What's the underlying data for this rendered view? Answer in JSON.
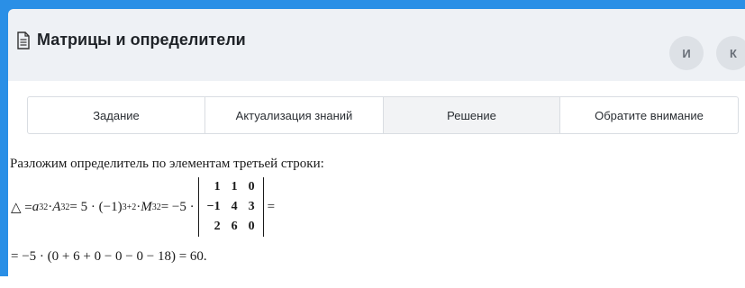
{
  "header": {
    "title": "Матрицы и определители",
    "avatars": [
      "И",
      "К"
    ]
  },
  "tabs": [
    {
      "label": "Задание",
      "active": false
    },
    {
      "label": "Актуализация знаний",
      "active": false
    },
    {
      "label": "Решение",
      "active": true
    },
    {
      "label": "Обратите внимание",
      "active": false
    }
  ],
  "solution": {
    "intro": "Разложим определитель по элементам третьей строки:",
    "eq1": {
      "lhs": "△ = ",
      "a": "a",
      "a_sub": "32",
      "dot1": " · ",
      "A": "A",
      "A_sub": "32",
      "eq": " = 5 · (−1)",
      "exp": "3+2",
      "dot2": " · ",
      "M": "M",
      "M_sub": "32",
      "rhs": " = −5 ·",
      "tail": "="
    },
    "matrix": [
      [
        "1",
        "1",
        "0"
      ],
      [
        "−1",
        "4",
        "3"
      ],
      [
        "2",
        "6",
        "0"
      ]
    ],
    "eq2": "= −5 · (0 + 6 + 0 − 0 − 0 − 18) = 60."
  },
  "colors": {
    "frame": "#2a8fe6",
    "header_bg": "#eef1f5",
    "active_tab": "#f2f3f5"
  }
}
